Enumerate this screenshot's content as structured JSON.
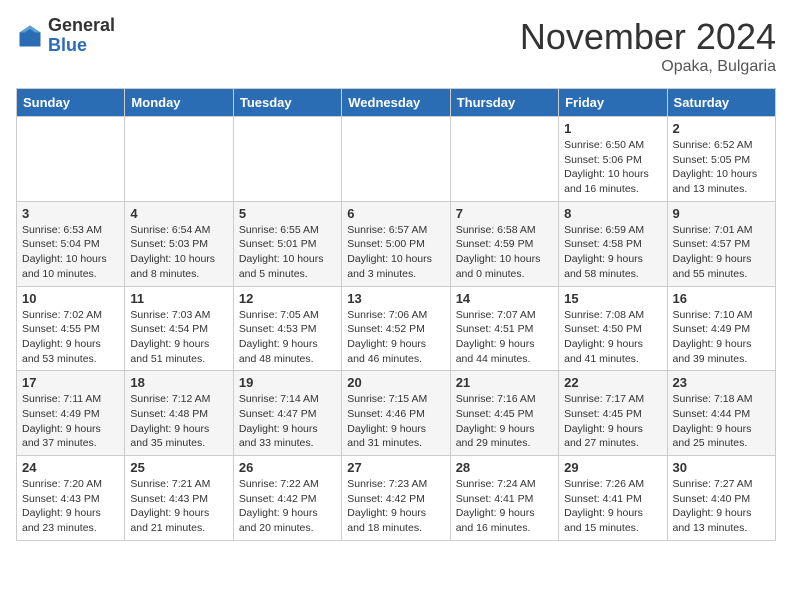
{
  "logo": {
    "general": "General",
    "blue": "Blue"
  },
  "title": "November 2024",
  "location": "Opaka, Bulgaria",
  "days_header": [
    "Sunday",
    "Monday",
    "Tuesday",
    "Wednesday",
    "Thursday",
    "Friday",
    "Saturday"
  ],
  "weeks": [
    [
      {
        "day": "",
        "info": ""
      },
      {
        "day": "",
        "info": ""
      },
      {
        "day": "",
        "info": ""
      },
      {
        "day": "",
        "info": ""
      },
      {
        "day": "",
        "info": ""
      },
      {
        "day": "1",
        "info": "Sunrise: 6:50 AM\nSunset: 5:06 PM\nDaylight: 10 hours and 16 minutes."
      },
      {
        "day": "2",
        "info": "Sunrise: 6:52 AM\nSunset: 5:05 PM\nDaylight: 10 hours and 13 minutes."
      }
    ],
    [
      {
        "day": "3",
        "info": "Sunrise: 6:53 AM\nSunset: 5:04 PM\nDaylight: 10 hours and 10 minutes."
      },
      {
        "day": "4",
        "info": "Sunrise: 6:54 AM\nSunset: 5:03 PM\nDaylight: 10 hours and 8 minutes."
      },
      {
        "day": "5",
        "info": "Sunrise: 6:55 AM\nSunset: 5:01 PM\nDaylight: 10 hours and 5 minutes."
      },
      {
        "day": "6",
        "info": "Sunrise: 6:57 AM\nSunset: 5:00 PM\nDaylight: 10 hours and 3 minutes."
      },
      {
        "day": "7",
        "info": "Sunrise: 6:58 AM\nSunset: 4:59 PM\nDaylight: 10 hours and 0 minutes."
      },
      {
        "day": "8",
        "info": "Sunrise: 6:59 AM\nSunset: 4:58 PM\nDaylight: 9 hours and 58 minutes."
      },
      {
        "day": "9",
        "info": "Sunrise: 7:01 AM\nSunset: 4:57 PM\nDaylight: 9 hours and 55 minutes."
      }
    ],
    [
      {
        "day": "10",
        "info": "Sunrise: 7:02 AM\nSunset: 4:55 PM\nDaylight: 9 hours and 53 minutes."
      },
      {
        "day": "11",
        "info": "Sunrise: 7:03 AM\nSunset: 4:54 PM\nDaylight: 9 hours and 51 minutes."
      },
      {
        "day": "12",
        "info": "Sunrise: 7:05 AM\nSunset: 4:53 PM\nDaylight: 9 hours and 48 minutes."
      },
      {
        "day": "13",
        "info": "Sunrise: 7:06 AM\nSunset: 4:52 PM\nDaylight: 9 hours and 46 minutes."
      },
      {
        "day": "14",
        "info": "Sunrise: 7:07 AM\nSunset: 4:51 PM\nDaylight: 9 hours and 44 minutes."
      },
      {
        "day": "15",
        "info": "Sunrise: 7:08 AM\nSunset: 4:50 PM\nDaylight: 9 hours and 41 minutes."
      },
      {
        "day": "16",
        "info": "Sunrise: 7:10 AM\nSunset: 4:49 PM\nDaylight: 9 hours and 39 minutes."
      }
    ],
    [
      {
        "day": "17",
        "info": "Sunrise: 7:11 AM\nSunset: 4:49 PM\nDaylight: 9 hours and 37 minutes."
      },
      {
        "day": "18",
        "info": "Sunrise: 7:12 AM\nSunset: 4:48 PM\nDaylight: 9 hours and 35 minutes."
      },
      {
        "day": "19",
        "info": "Sunrise: 7:14 AM\nSunset: 4:47 PM\nDaylight: 9 hours and 33 minutes."
      },
      {
        "day": "20",
        "info": "Sunrise: 7:15 AM\nSunset: 4:46 PM\nDaylight: 9 hours and 31 minutes."
      },
      {
        "day": "21",
        "info": "Sunrise: 7:16 AM\nSunset: 4:45 PM\nDaylight: 9 hours and 29 minutes."
      },
      {
        "day": "22",
        "info": "Sunrise: 7:17 AM\nSunset: 4:45 PM\nDaylight: 9 hours and 27 minutes."
      },
      {
        "day": "23",
        "info": "Sunrise: 7:18 AM\nSunset: 4:44 PM\nDaylight: 9 hours and 25 minutes."
      }
    ],
    [
      {
        "day": "24",
        "info": "Sunrise: 7:20 AM\nSunset: 4:43 PM\nDaylight: 9 hours and 23 minutes."
      },
      {
        "day": "25",
        "info": "Sunrise: 7:21 AM\nSunset: 4:43 PM\nDaylight: 9 hours and 21 minutes."
      },
      {
        "day": "26",
        "info": "Sunrise: 7:22 AM\nSunset: 4:42 PM\nDaylight: 9 hours and 20 minutes."
      },
      {
        "day": "27",
        "info": "Sunrise: 7:23 AM\nSunset: 4:42 PM\nDaylight: 9 hours and 18 minutes."
      },
      {
        "day": "28",
        "info": "Sunrise: 7:24 AM\nSunset: 4:41 PM\nDaylight: 9 hours and 16 minutes."
      },
      {
        "day": "29",
        "info": "Sunrise: 7:26 AM\nSunset: 4:41 PM\nDaylight: 9 hours and 15 minutes."
      },
      {
        "day": "30",
        "info": "Sunrise: 7:27 AM\nSunset: 4:40 PM\nDaylight: 9 hours and 13 minutes."
      }
    ]
  ]
}
